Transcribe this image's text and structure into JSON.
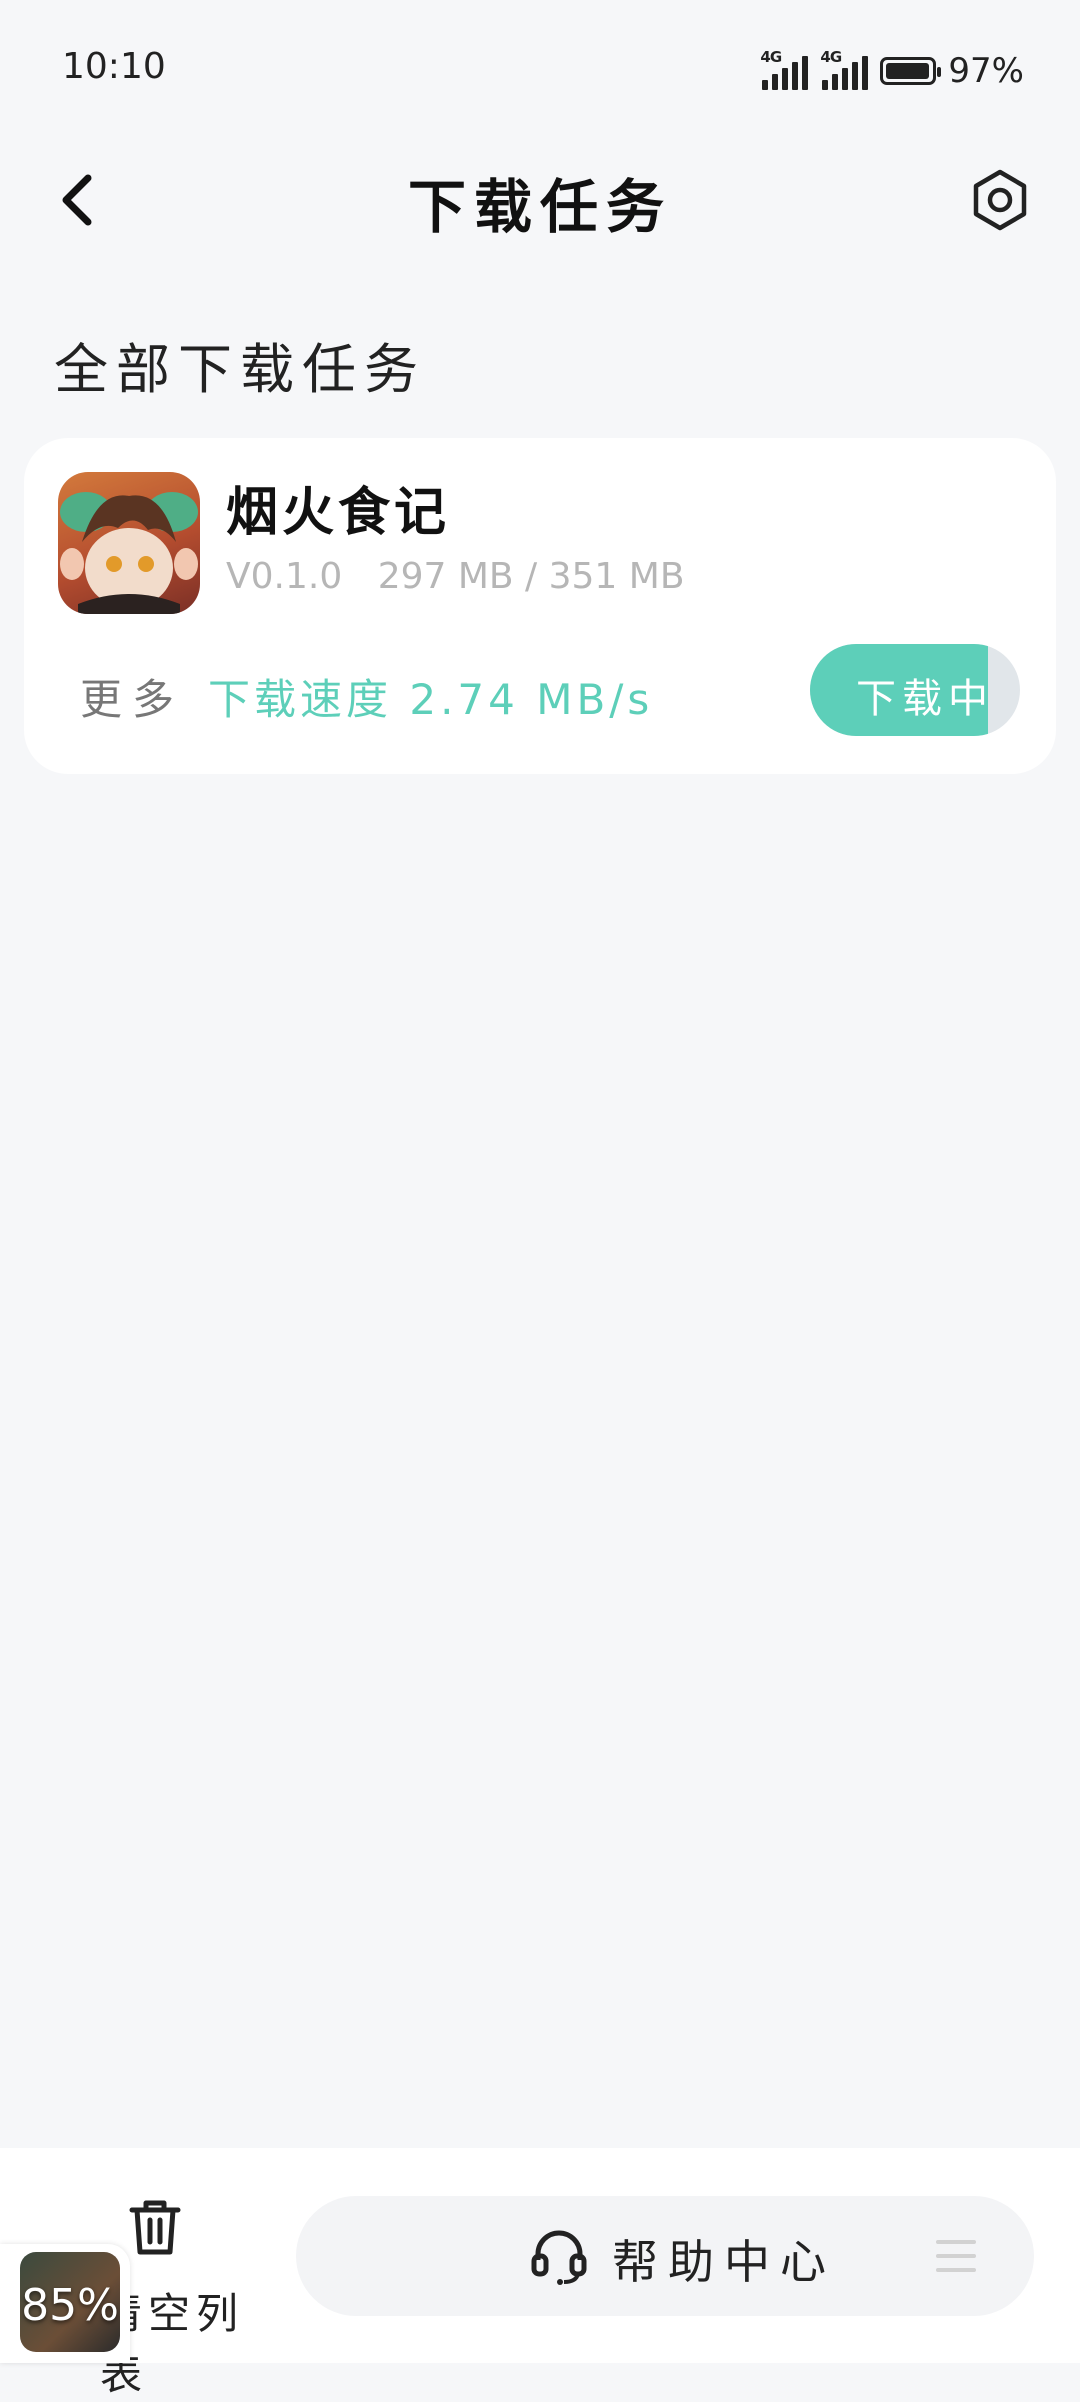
{
  "status_bar": {
    "time": "10:10",
    "network1": "4G",
    "network2": "4G",
    "battery": "97%"
  },
  "header": {
    "title": "下载任务"
  },
  "section": {
    "title": "全部下载任务"
  },
  "task": {
    "name": "烟火食记",
    "version": "V0.1.0",
    "size": "297 MB / 351 MB",
    "more_label": "更多",
    "speed": "下载速度 2.74 MB/s",
    "status_label": "下载中",
    "progress": 0.846
  },
  "bottom_bar": {
    "clear_label": "清空列表",
    "help_label": "帮助中心"
  },
  "floating_badge": {
    "percent": "85%"
  },
  "colors": {
    "accent": "#5dcfb9",
    "background": "#f6f7f9"
  }
}
